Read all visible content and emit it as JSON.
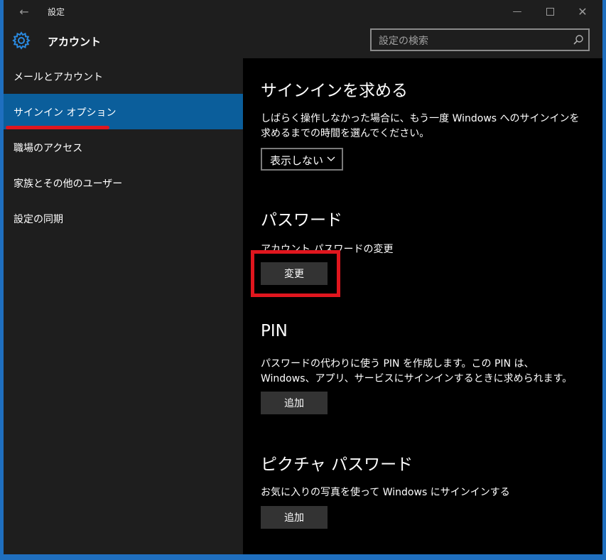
{
  "window": {
    "back_glyph": "←",
    "title": "設定",
    "min_glyph": "—",
    "close_glyph": "✕"
  },
  "header": {
    "title": "アカウント",
    "search_placeholder": "設定の検索"
  },
  "sidebar": {
    "items": [
      {
        "label": "メールとアカウント"
      },
      {
        "label": "サインイン オプション",
        "active": true
      },
      {
        "label": "職場のアクセス"
      },
      {
        "label": "家族とその他のユーザー"
      },
      {
        "label": "設定の同期"
      }
    ]
  },
  "content": {
    "require_signin": {
      "heading": "サインインを求める",
      "description": "しばらく操作しなかった場合に、もう一度 Windows へのサインインを求めるまでの時間を選んでください。",
      "dropdown_value": "表示しない"
    },
    "password": {
      "heading": "パスワード",
      "description": "アカウント パスワードの変更",
      "button": "変更"
    },
    "pin": {
      "heading": "PIN",
      "description": "パスワードの代わりに使う PIN を作成します。この PIN は、Windows、アプリ、サービスにサインインするときに求められます。",
      "button": "追加"
    },
    "picture_password": {
      "heading": "ピクチャ パスワード",
      "description": "お気に入りの写真を使って Windows にサインインする",
      "button": "追加"
    }
  },
  "colors": {
    "accent": "#0b5e9b",
    "highlight": "#e0161e",
    "frame": "#1f6fbf"
  }
}
